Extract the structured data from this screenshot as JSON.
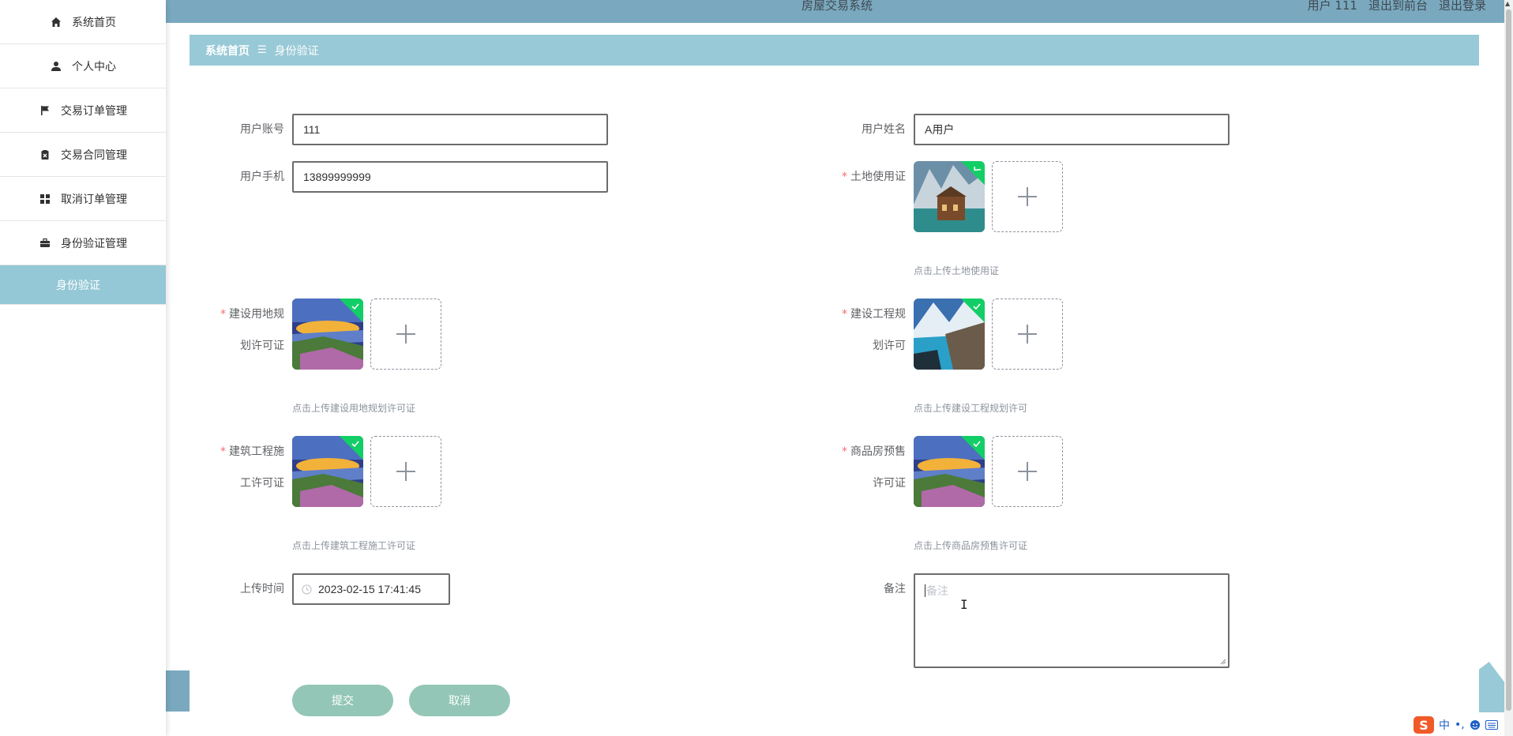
{
  "sidebar": {
    "items": [
      {
        "label": "系统首页",
        "icon": "home-icon"
      },
      {
        "label": "个人中心",
        "icon": "user-icon"
      },
      {
        "label": "交易订单管理",
        "icon": "flag-icon"
      },
      {
        "label": "交易合同管理",
        "icon": "clipboard-icon"
      },
      {
        "label": "取消订单管理",
        "icon": "grid-icon"
      },
      {
        "label": "身份验证管理",
        "icon": "briefcase-icon"
      },
      {
        "label": "身份验证",
        "icon": ""
      }
    ]
  },
  "header": {
    "title": "房屋交易系统",
    "user_label": "用户 111",
    "front_link": "退出到前台",
    "logout_link": "退出登录"
  },
  "breadcrumb": {
    "home": "系统首页",
    "separator": "☰",
    "current": "身份验证"
  },
  "form": {
    "account": {
      "label": "用户账号",
      "value": "111"
    },
    "name": {
      "label": "用户姓名",
      "value": "A用户"
    },
    "phone": {
      "label": "用户手机",
      "value": "13899999999"
    },
    "land": {
      "label": "土地使用证",
      "hint": "点击上传土地使用证"
    },
    "planning_land": {
      "label_1": "建设用地规",
      "label_2": "划许可证",
      "hint": "点击上传建设用地规划许可证"
    },
    "planning_project": {
      "label_1": "建设工程规",
      "label_2": "划许可",
      "hint": "点击上传建设工程规划许可"
    },
    "construction": {
      "label_1": "建筑工程施",
      "label_2": "工许可证",
      "hint": "点击上传建筑工程施工许可证"
    },
    "presale": {
      "label_1": "商品房预售",
      "label_2": "许可证",
      "hint": "点击上传商品房预售许可证"
    },
    "upload_time": {
      "label": "上传时间",
      "value": "2023-02-15 17:41:45"
    },
    "remark": {
      "label": "备注",
      "placeholder": "备注"
    },
    "required_mark": "*",
    "plus": "+"
  },
  "buttons": {
    "submit": "提交",
    "cancel": "取消"
  },
  "ime": {
    "logo": "S",
    "lang": "中",
    "punct": "•,"
  },
  "colors": {
    "accent": "#98c9d6",
    "header": "#7aa9bf",
    "button": "#93c6b6",
    "required": "#f56c6c"
  }
}
